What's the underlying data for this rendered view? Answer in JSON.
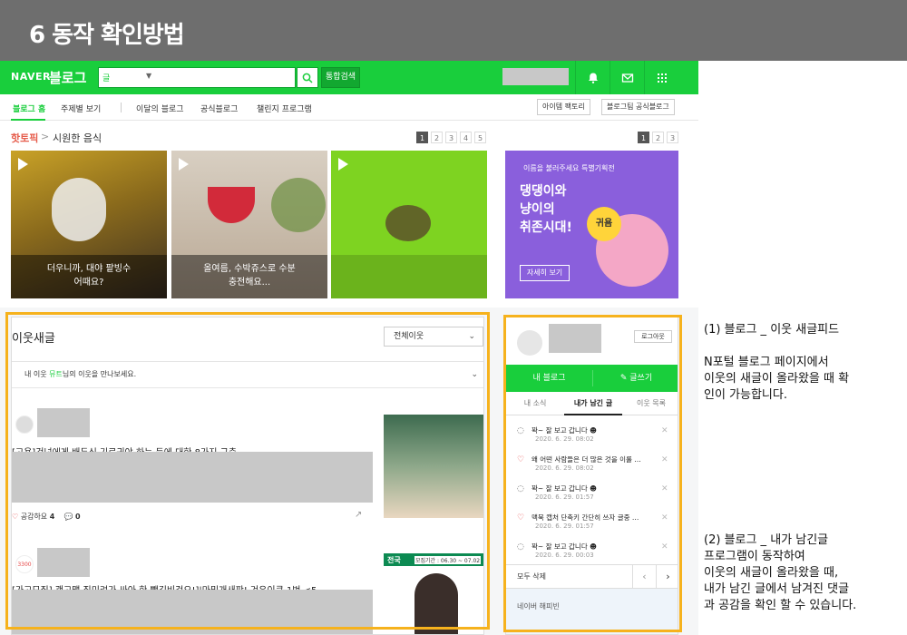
{
  "slide": {
    "title": "6 동작 확인방법"
  },
  "naver": {
    "logo_naver": "NAVER",
    "logo_blog": "블로그",
    "search_select": "글",
    "search_button": "통합검색",
    "nav": {
      "items": [
        "블로그 홈",
        "주제별 보기",
        "이달의 블로그",
        "공식블로그",
        "챌린지 프로그램"
      ],
      "right_buttons": [
        "아이템 팩토리",
        "블로그팀 공식블로그"
      ]
    },
    "hot": {
      "label": "핫토픽",
      "arrow": ">",
      "topic": "시원한 음식",
      "pager_main": [
        "1",
        "2",
        "3",
        "4",
        "5"
      ],
      "pager_ad": [
        "1",
        "2",
        "3"
      ],
      "thumbs": [
        {
          "caption_line1": "더우니까, 대야 팥빙수",
          "caption_line2": "어때요?"
        },
        {
          "caption_line1": "올여름, 수박쥬스로 수분",
          "caption_line2": "충전해요..."
        },
        {
          "caption_line1": "",
          "caption_line2": ""
        }
      ]
    },
    "ad": {
      "top": "이름을 불러주세요 특별기획전",
      "main_line1": "댕댕이와",
      "main_line2": "냥이의",
      "main_line3": "취존시대!",
      "badge": "귀욤",
      "button": "자세히 보기"
    },
    "feed": {
      "title": "이웃새글",
      "select": "전체이웃",
      "notice_pre": "내 이웃 ",
      "notice_hl": "뮤트",
      "notice_post": "님의 이웃을 만나보세요.",
      "post1_title": "[고용]건넌에게 배두신 기로귀야 하는 등에 대한 8가지 규충",
      "post1_likes_label": "공감하요",
      "post1_likes": "4",
      "post1_comments": "0",
      "post2_badge": "3300",
      "post2_title": "[가고모집] 괜고맵 짐미려가 싸아 한 빽김비겁요!]|마밈개새판! 겨유이큰 1번 <5",
      "post2_img_tag": "전국",
      "post2_img_time": "모집기간 : 06.30 ~ 07.02"
    },
    "side": {
      "logout": "로그아웃",
      "my_blog": "내 블로그",
      "write": "글쓰기",
      "tabs": [
        "내 소식",
        "내가 남긴 글",
        "이웃 목록"
      ],
      "notifications": [
        {
          "icon": "comment",
          "text": "꽉~ 잘 보고 갑니다 ☻",
          "date": "2020. 6. 29. 08:02"
        },
        {
          "icon": "heart",
          "text": "왜 어떤 사람들은 더 많은 것을 이룰 …",
          "date": "2020. 6. 29. 08:02"
        },
        {
          "icon": "comment",
          "text": "꽉~ 잘 보고 갑니다 ☻",
          "date": "2020. 6. 29. 01:57"
        },
        {
          "icon": "heart",
          "text": "맥북 캡처 단축키 간단히 쓰자 글중 …",
          "date": "2020. 6. 29. 01:57"
        },
        {
          "icon": "comment",
          "text": "꽉~ 잘 보고 갑니다 ☻",
          "date": "2020. 6. 29. 00:03"
        }
      ],
      "delete_all": "모두 삭제",
      "happybean": "네이버 해피빈"
    }
  },
  "annotations": {
    "note1": {
      "title": "(1) 블로그 _ 이웃 새글피드",
      "line1": "N포털 블로그 페이지에서",
      "line2": "이웃의 새글이 올라왔을 때 확",
      "line3": "인이 가능합니다."
    },
    "note2": {
      "line1": "(2) 블로그 _ 내가 남긴글",
      "line2": "프로그램이 동작하여",
      "line3": "이웃의 새글이 올라왔을 때,",
      "line4": "내가 남긴 글에서 남겨진 댓글",
      "line5": "과 공감을 확인 할 수 있습니다."
    }
  },
  "colors": {
    "naver_green": "#19ce3c",
    "highlight": "#f6b21d",
    "header_gray": "#6e6e6e"
  }
}
